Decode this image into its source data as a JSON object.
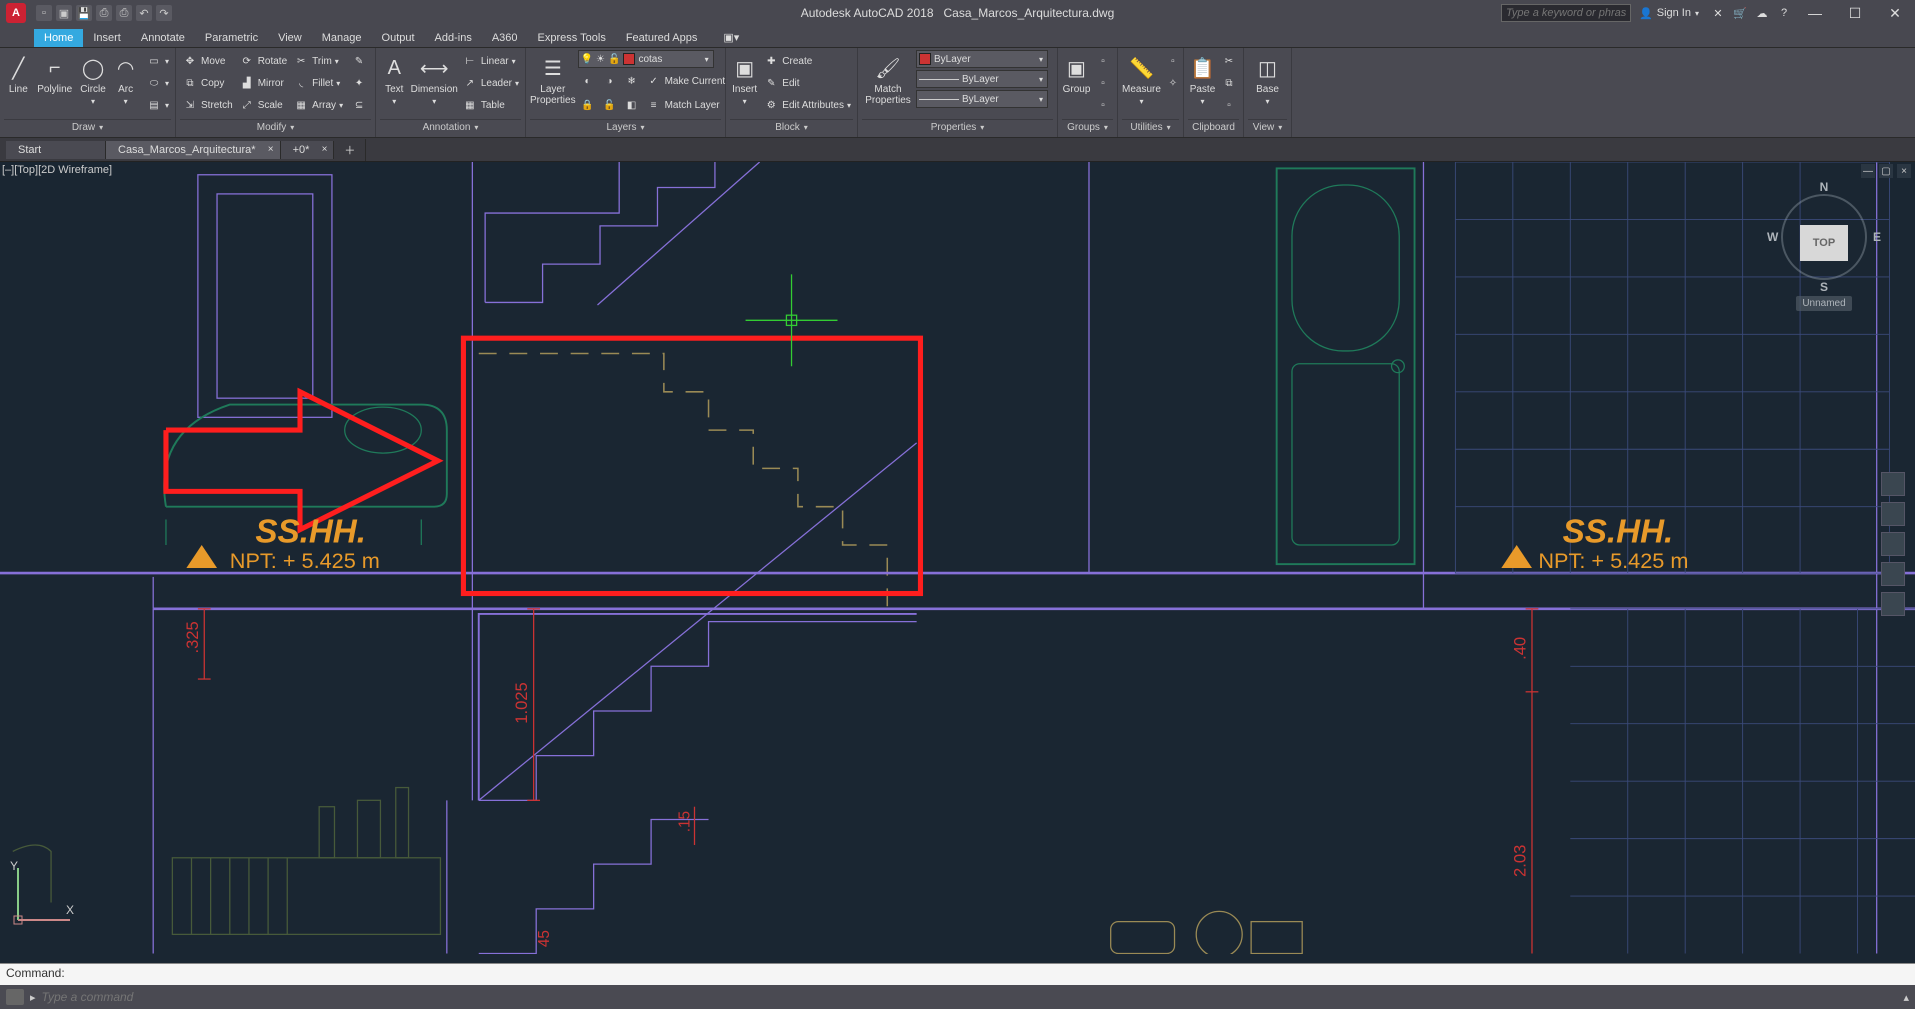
{
  "app": {
    "title_app": "Autodesk AutoCAD 2018",
    "title_doc": "Casa_Marcos_Arquitectura.dwg",
    "search_placeholder": "Type a keyword or phrase",
    "sign_in": "Sign In"
  },
  "tabs": [
    "Home",
    "Insert",
    "Annotate",
    "Parametric",
    "View",
    "Manage",
    "Output",
    "Add-ins",
    "A360",
    "Express Tools",
    "Featured Apps"
  ],
  "active_tab": "Home",
  "file_tabs": {
    "start": "Start",
    "active": "Casa_Marcos_Arquitectura*",
    "other": "+0*"
  },
  "ribbon": {
    "draw": {
      "label": "Draw",
      "line": "Line",
      "polyline": "Polyline",
      "circle": "Circle",
      "arc": "Arc"
    },
    "modify": {
      "label": "Modify",
      "move": "Move",
      "rotate": "Rotate",
      "trim": "Trim",
      "copy": "Copy",
      "mirror": "Mirror",
      "fillet": "Fillet",
      "stretch": "Stretch",
      "scale": "Scale",
      "array": "Array"
    },
    "annotation": {
      "label": "Annotation",
      "text": "Text",
      "dimension": "Dimension",
      "linear": "Linear",
      "leader": "Leader",
      "table": "Table"
    },
    "layers": {
      "label": "Layers",
      "layerprops": "Layer\nProperties",
      "current": "cotas",
      "makecurrent": "Make Current",
      "matchlayer": "Match Layer"
    },
    "block": {
      "label": "Block",
      "insert": "Insert",
      "create": "Create",
      "edit": "Edit",
      "editattr": "Edit Attributes"
    },
    "properties": {
      "label": "Properties",
      "match": "Match\nProperties",
      "bylayer": "ByLayer"
    },
    "groups": {
      "label": "Groups",
      "group": "Group"
    },
    "utilities": {
      "label": "Utilities",
      "measure": "Measure"
    },
    "clipboard": {
      "label": "Clipboard",
      "paste": "Paste"
    },
    "view": {
      "label": "View",
      "base": "Base"
    }
  },
  "viewport": {
    "label": "[–][Top][2D Wireframe]",
    "cube_top": "TOP",
    "n": "N",
    "s": "S",
    "e": "E",
    "w": "W",
    "unnamed": "Unnamed"
  },
  "drawing": {
    "label1": "SS.HH.",
    "npt1": "NPT: + 5.425 m",
    "label2": "SS.HH.",
    "npt2": "NPT: + 5.425 m",
    "dim_325": ".325",
    "dim_1025": "1.025",
    "dim_15": ".15",
    "dim_40": ".40",
    "dim_203": "2.03",
    "dim_45": "45"
  },
  "cmd": {
    "hist": "Command:",
    "placeholder": "Type a command"
  },
  "ucs": {
    "y": "Y",
    "x": "X"
  }
}
